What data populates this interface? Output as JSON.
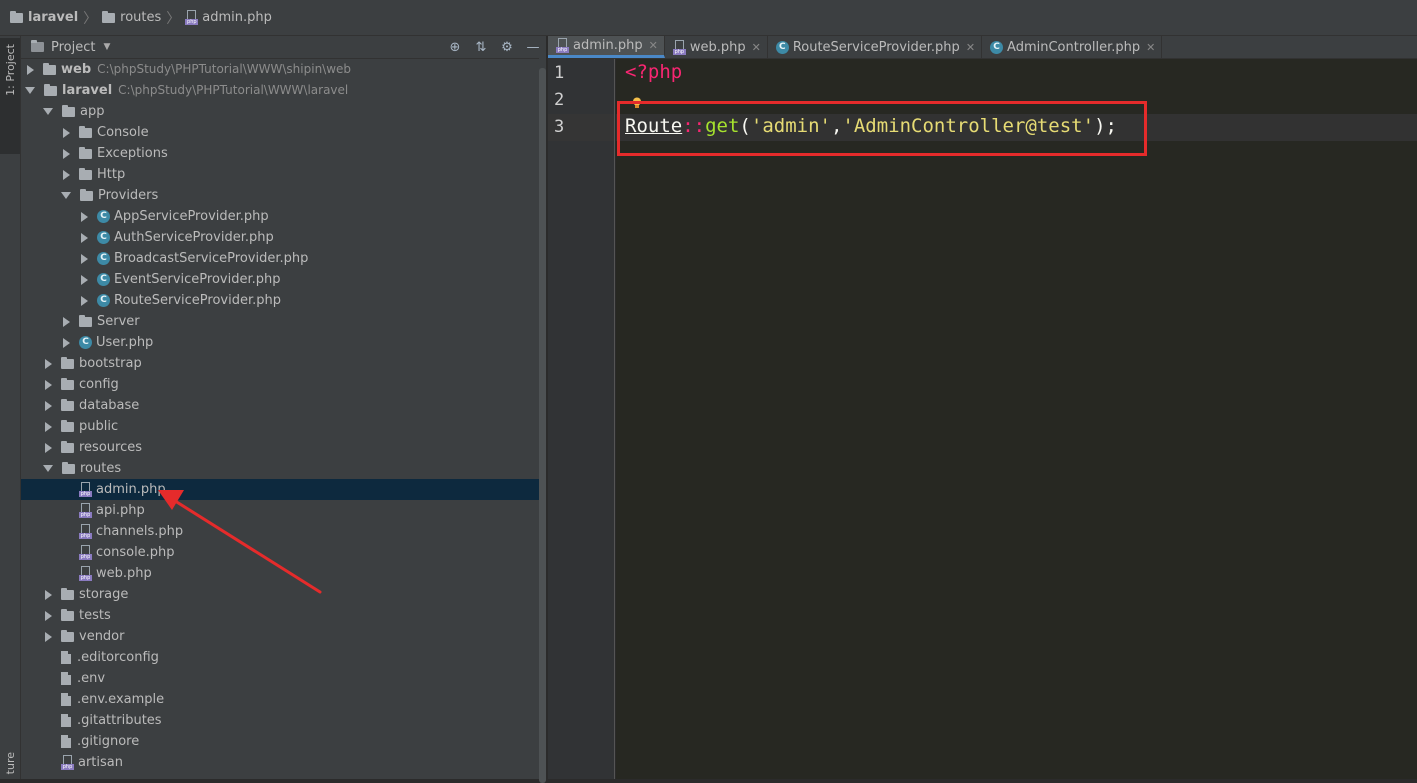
{
  "breadcrumb": [
    {
      "label": "laravel",
      "icon": "folder-icon"
    },
    {
      "label": "routes",
      "icon": "folder-icon"
    },
    {
      "label": "admin.php",
      "icon": "php-file-icon"
    }
  ],
  "left_strip": {
    "project_tab": "1: Project",
    "structure_tab": "ture"
  },
  "project_panel": {
    "title": "Project",
    "tools": [
      "target-icon",
      "collapse-icon",
      "gear-icon",
      "hide-icon"
    ]
  },
  "tree": [
    {
      "name": "web",
      "path": "C:\\phpStudy\\PHPTutorial\\WWW\\shipin\\web",
      "depth": 0,
      "arrow": "right",
      "icon": "folder",
      "bold": true
    },
    {
      "name": "laravel",
      "path": "C:\\phpStudy\\PHPTutorial\\WWW\\laravel",
      "depth": 0,
      "arrow": "down",
      "icon": "folder",
      "bold": true
    },
    {
      "name": "app",
      "depth": 1,
      "arrow": "down",
      "icon": "folder"
    },
    {
      "name": "Console",
      "depth": 2,
      "arrow": "right",
      "icon": "folder"
    },
    {
      "name": "Exceptions",
      "depth": 2,
      "arrow": "right",
      "icon": "folder"
    },
    {
      "name": "Http",
      "depth": 2,
      "arrow": "right",
      "icon": "folder"
    },
    {
      "name": "Providers",
      "depth": 2,
      "arrow": "down",
      "icon": "folder"
    },
    {
      "name": "AppServiceProvider.php",
      "depth": 3,
      "arrow": "right",
      "icon": "class"
    },
    {
      "name": "AuthServiceProvider.php",
      "depth": 3,
      "arrow": "right",
      "icon": "class"
    },
    {
      "name": "BroadcastServiceProvider.php",
      "depth": 3,
      "arrow": "right",
      "icon": "class"
    },
    {
      "name": "EventServiceProvider.php",
      "depth": 3,
      "arrow": "right",
      "icon": "class"
    },
    {
      "name": "RouteServiceProvider.php",
      "depth": 3,
      "arrow": "right",
      "icon": "class"
    },
    {
      "name": "Server",
      "depth": 2,
      "arrow": "right",
      "icon": "folder"
    },
    {
      "name": "User.php",
      "depth": 2,
      "arrow": "right",
      "icon": "class"
    },
    {
      "name": "bootstrap",
      "depth": 1,
      "arrow": "right",
      "icon": "folder"
    },
    {
      "name": "config",
      "depth": 1,
      "arrow": "right",
      "icon": "folder"
    },
    {
      "name": "database",
      "depth": 1,
      "arrow": "right",
      "icon": "folder"
    },
    {
      "name": "public",
      "depth": 1,
      "arrow": "right",
      "icon": "folder"
    },
    {
      "name": "resources",
      "depth": 1,
      "arrow": "right",
      "icon": "folder"
    },
    {
      "name": "routes",
      "depth": 1,
      "arrow": "down",
      "icon": "folder"
    },
    {
      "name": "admin.php",
      "depth": 2,
      "arrow": "none",
      "icon": "php",
      "selected": true
    },
    {
      "name": "api.php",
      "depth": 2,
      "arrow": "none",
      "icon": "php"
    },
    {
      "name": "channels.php",
      "depth": 2,
      "arrow": "none",
      "icon": "php"
    },
    {
      "name": "console.php",
      "depth": 2,
      "arrow": "none",
      "icon": "php"
    },
    {
      "name": "web.php",
      "depth": 2,
      "arrow": "none",
      "icon": "php"
    },
    {
      "name": "storage",
      "depth": 1,
      "arrow": "right",
      "icon": "folder"
    },
    {
      "name": "tests",
      "depth": 1,
      "arrow": "right",
      "icon": "folder"
    },
    {
      "name": "vendor",
      "depth": 1,
      "arrow": "right",
      "icon": "folder"
    },
    {
      "name": ".editorconfig",
      "depth": 1,
      "arrow": "none",
      "icon": "file"
    },
    {
      "name": ".env",
      "depth": 1,
      "arrow": "none",
      "icon": "file"
    },
    {
      "name": ".env.example",
      "depth": 1,
      "arrow": "none",
      "icon": "file"
    },
    {
      "name": ".gitattributes",
      "depth": 1,
      "arrow": "none",
      "icon": "file"
    },
    {
      "name": ".gitignore",
      "depth": 1,
      "arrow": "none",
      "icon": "file"
    },
    {
      "name": "artisan",
      "depth": 1,
      "arrow": "none",
      "icon": "php"
    }
  ],
  "editor_tabs": [
    {
      "label": "admin.php",
      "icon": "php",
      "active": true
    },
    {
      "label": "web.php",
      "icon": "php"
    },
    {
      "label": "RouteServiceProvider.php",
      "icon": "class"
    },
    {
      "label": "AdminController.php",
      "icon": "class"
    }
  ],
  "editor": {
    "line_numbers": [
      "1",
      "2",
      "3"
    ],
    "line1": "<?php",
    "line3": {
      "class": "Route",
      "op": "::",
      "fn": "get",
      "open": "(",
      "arg1": "'admin'",
      "comma": ",",
      "arg2": "'AdminController@test'",
      "close": ");"
    }
  },
  "annotation_color": "#e52b2b"
}
